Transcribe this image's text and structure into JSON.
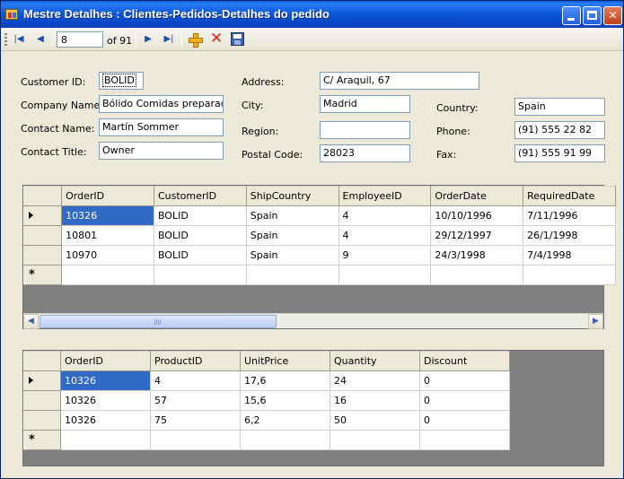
{
  "window": {
    "title": "Mestre Detalhes : Clientes-Pedidos-Detalhes do pedido",
    "minimize_glyph": "_",
    "close_glyph": "✕"
  },
  "navigator": {
    "position_value": "8",
    "count_text": "of 91",
    "icons": [
      "move-first-icon",
      "move-previous-icon",
      "move-next-icon",
      "move-last-icon",
      "add-new-icon",
      "delete-icon",
      "save-icon"
    ]
  },
  "customer": {
    "labels": {
      "customer_id": "Customer ID:",
      "company_name": "Company Name:",
      "contact_name": "Contact Name:",
      "contact_title": "Contact Title:",
      "address": "Address:",
      "city": "City:",
      "region": "Region:",
      "postal_code": "Postal Code:",
      "country": "Country:",
      "phone": "Phone:",
      "fax": "Fax:"
    },
    "values": {
      "customer_id": "BOLID",
      "company_name": "Bólido Comidas preparadas",
      "contact_name": "Martín Sommer",
      "contact_title": "Owner",
      "address": "C/ Araquil, 67",
      "city": "Madrid",
      "region": "",
      "postal_code": "28023",
      "country": "Spain",
      "phone": "(91) 555 22 82",
      "fax": "(91) 555 91 99"
    }
  },
  "orders_grid": {
    "columns": [
      "OrderID",
      "CustomerID",
      "ShipCountry",
      "EmployeeID",
      "OrderDate",
      "RequiredDate"
    ],
    "rows": [
      [
        "10326",
        "BOLID",
        "Spain",
        "4",
        "10/10/1996",
        "7/11/1996"
      ],
      [
        "10801",
        "BOLID",
        "Spain",
        "4",
        "29/12/1997",
        "26/1/1998"
      ],
      [
        "10970",
        "BOLID",
        "Spain",
        "9",
        "24/3/1998",
        "7/4/1998"
      ]
    ],
    "new_row_glyph": "*"
  },
  "details_grid": {
    "columns": [
      "OrderID",
      "ProductID",
      "UnitPrice",
      "Quantity",
      "Discount"
    ],
    "rows": [
      [
        "10326",
        "4",
        "17,6",
        "24",
        "0"
      ],
      [
        "10326",
        "57",
        "15,6",
        "16",
        "0"
      ],
      [
        "10326",
        "75",
        "6,2",
        "50",
        "0"
      ]
    ],
    "new_row_glyph": "*"
  },
  "colors": {
    "title_bar": "#0b55d8",
    "selection": "#316ac5",
    "grid_background": "#808080",
    "form_background": "#ece9d8"
  }
}
